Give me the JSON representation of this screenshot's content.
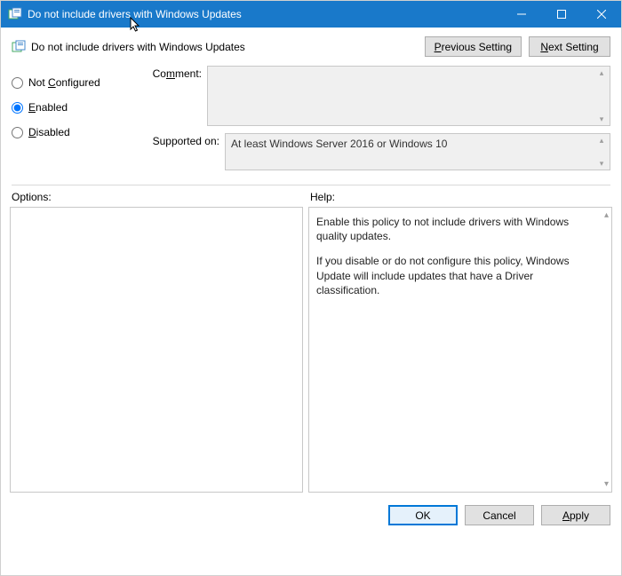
{
  "window": {
    "title": "Do not include drivers with Windows Updates"
  },
  "header": {
    "policy_title": "Do not include drivers with Windows Updates",
    "prev_label_pre": "",
    "prev_label_u": "P",
    "prev_label_post": "revious Setting",
    "next_label_pre": "",
    "next_label_u": "N",
    "next_label_post": "ext Setting"
  },
  "state": {
    "not_configured_pre": "Not ",
    "not_configured_u": "C",
    "not_configured_post": "onfigured",
    "enabled_u": "E",
    "enabled_post": "nabled",
    "disabled_u": "D",
    "disabled_post": "isabled",
    "selected": "enabled"
  },
  "fields": {
    "comment_label": "Co",
    "comment_label_u": "m",
    "comment_label_post": "ment:",
    "comment_value": "",
    "supported_label": "Supported on:",
    "supported_value": "At least Windows Server 2016 or Windows 10"
  },
  "lower": {
    "options_label": "Options:",
    "help_label": "Help:",
    "help_para1": "Enable this policy to not include drivers with Windows quality updates.",
    "help_para2": "If you disable or do not configure this policy, Windows Update will include updates that have a Driver classification."
  },
  "footer": {
    "ok": "OK",
    "cancel": "Cancel",
    "apply_u": "A",
    "apply_post": "pply"
  }
}
